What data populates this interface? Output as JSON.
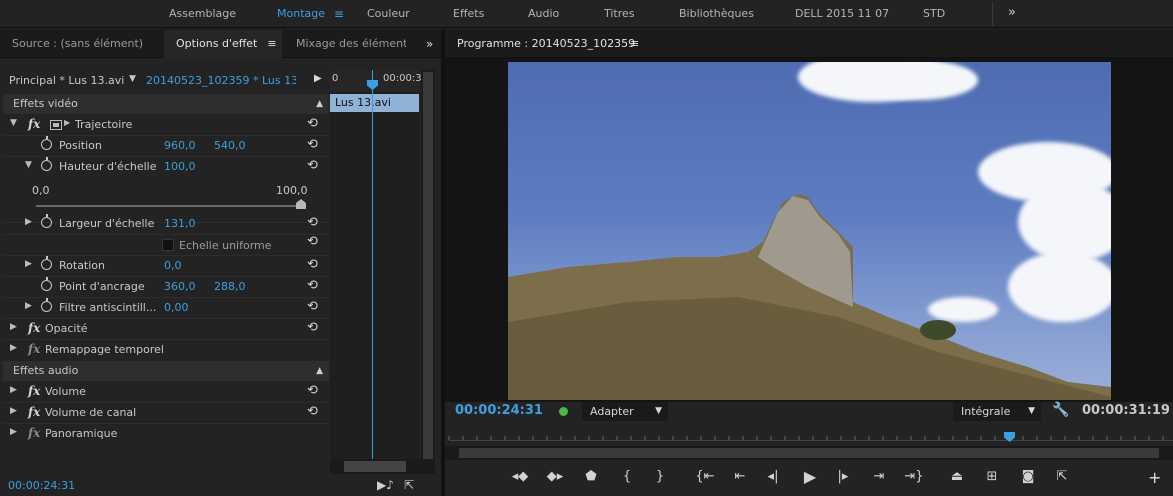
{
  "workspace": {
    "tabs": [
      {
        "label": "Assemblage"
      },
      {
        "label": "Montage"
      },
      {
        "label": "Couleur"
      },
      {
        "label": "Effets"
      },
      {
        "label": "Audio"
      },
      {
        "label": "Titres"
      },
      {
        "label": "Bibliothèques"
      },
      {
        "label": "DELL 2015 11 07"
      },
      {
        "label": "STD"
      }
    ],
    "active_tab": "Montage",
    "menu_icon": "≡",
    "more_icon": "»"
  },
  "left_panel": {
    "tabs": [
      {
        "label": "Source : (sans élément)"
      },
      {
        "label": "Options d'effet"
      },
      {
        "label": "Mixage des éléments"
      }
    ],
    "active_tab": "Options d'effet",
    "header": {
      "master_clip": "Principal * Lus 13.avi",
      "sequence_clip": "20140523_102359 * Lus 13..."
    },
    "ruler": {
      "start": "0",
      "end": "00:00:3"
    },
    "clip_label": "Lus 13.avi",
    "video_section": "Effets vidéo",
    "audio_section": "Effets audio",
    "effects": {
      "trajectoire": "Trajectoire",
      "position": {
        "label": "Position",
        "x": "960,0",
        "y": "540,0"
      },
      "scale_height": {
        "label": "Hauteur d'échelle",
        "value": "100,0"
      },
      "slider": {
        "min": "0,0",
        "max": "100,0",
        "level": 1.0
      },
      "scale_width": {
        "label": "Largeur d'échelle",
        "value": "131,0"
      },
      "uniform_scale": {
        "label": "Echelle uniforme",
        "checked": false
      },
      "rotation": {
        "label": "Rotation",
        "value": "0,0"
      },
      "anchor": {
        "label": "Point d'ancrage",
        "x": "360,0",
        "y": "288,0"
      },
      "flicker": {
        "label": "Filtre antiscintill...",
        "value": "0,00"
      },
      "opacity": "Opacité",
      "time_remap": "Remappage temporel",
      "volume": "Volume",
      "channel_volume": "Volume de canal",
      "panner": "Panoramique"
    },
    "footer_timecode": "00:00:24:31"
  },
  "monitor": {
    "title": "Programme : 20140523_102359",
    "current_timecode": "00:00:24:31",
    "duration_timecode": "00:00:31:19",
    "fit_option": "Adapter",
    "resolution_option": "Intégrale",
    "playhead_fraction": 0.78
  }
}
